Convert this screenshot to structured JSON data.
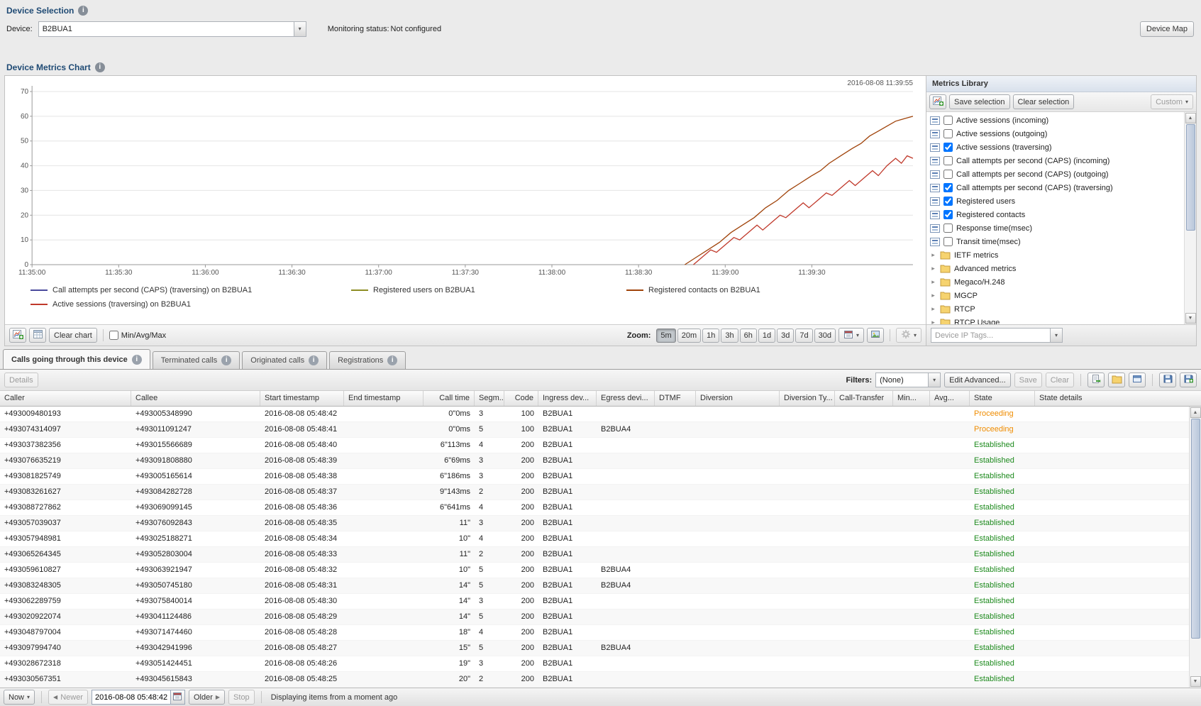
{
  "icons": {
    "caret_down": "▾",
    "caret_right": "▸",
    "arrow_left": "◀",
    "arrow_right": "▶",
    "info": "i"
  },
  "device_selection": {
    "title": "Device Selection",
    "device_label": "Device:",
    "device_value": "B2BUA1",
    "monitoring_label": "Monitoring status:",
    "monitoring_value": "Not configured",
    "device_map_button": "Device Map"
  },
  "metrics_chart": {
    "title": "Device Metrics Chart",
    "toolbar": {
      "clear_chart_button": "Clear chart",
      "min_avg_max_label": "Min/Avg/Max",
      "zoom_label": "Zoom:",
      "zoom_options": [
        "5m",
        "20m",
        "1h",
        "3h",
        "6h",
        "1d",
        "3d",
        "7d",
        "30d"
      ],
      "zoom_active": "5m"
    }
  },
  "chart_data": {
    "type": "line",
    "timestamp_label": "2016-08-08 11:39:55",
    "ylim": [
      0,
      70
    ],
    "y_ticks": [
      0,
      10,
      20,
      30,
      40,
      50,
      60,
      70
    ],
    "x_domain_seconds": [
      0,
      305
    ],
    "x_tick_interval_seconds": 30,
    "x_ticks": [
      "11:35:00",
      "11:35:30",
      "11:36:00",
      "11:36:30",
      "11:37:00",
      "11:37:30",
      "11:38:00",
      "11:38:30",
      "11:39:00",
      "11:39:30"
    ],
    "grid": "horizontal",
    "legend_position": "bottom",
    "series": [
      {
        "name": "Call attempts per second (CAPS) (traversing) on B2BUA1",
        "color": "#4a4a9c",
        "points": []
      },
      {
        "name": "Registered users on B2BUA1",
        "color": "#8e8e24",
        "points": []
      },
      {
        "name": "Registered contacts on B2BUA1",
        "color": "#a0430a",
        "points": [
          [
            226,
            0
          ],
          [
            230,
            3
          ],
          [
            234,
            6
          ],
          [
            238,
            9
          ],
          [
            242,
            13
          ],
          [
            246,
            16
          ],
          [
            250,
            19
          ],
          [
            254,
            23
          ],
          [
            258,
            26
          ],
          [
            262,
            30
          ],
          [
            266,
            33
          ],
          [
            270,
            36
          ],
          [
            273,
            38
          ],
          [
            276,
            41
          ],
          [
            280,
            44
          ],
          [
            284,
            47
          ],
          [
            287,
            49
          ],
          [
            290,
            52
          ],
          [
            293,
            54
          ],
          [
            296,
            56
          ],
          [
            299,
            58
          ],
          [
            302,
            59
          ],
          [
            305,
            60
          ]
        ]
      },
      {
        "name": "Active sessions (traversing) on B2BUA1",
        "color": "#c0392b",
        "points": [
          [
            229,
            0
          ],
          [
            232,
            3
          ],
          [
            235,
            6
          ],
          [
            237,
            5
          ],
          [
            240,
            8
          ],
          [
            243,
            11
          ],
          [
            245,
            10
          ],
          [
            248,
            13
          ],
          [
            251,
            16
          ],
          [
            253,
            14
          ],
          [
            256,
            17
          ],
          [
            259,
            20
          ],
          [
            261,
            19
          ],
          [
            264,
            22
          ],
          [
            267,
            25
          ],
          [
            269,
            23
          ],
          [
            272,
            26
          ],
          [
            275,
            29
          ],
          [
            277,
            28
          ],
          [
            280,
            31
          ],
          [
            283,
            34
          ],
          [
            285,
            32
          ],
          [
            288,
            35
          ],
          [
            291,
            38
          ],
          [
            293,
            36
          ],
          [
            296,
            40
          ],
          [
            299,
            43
          ],
          [
            301,
            41
          ],
          [
            303,
            44
          ],
          [
            305,
            43
          ]
        ]
      }
    ]
  },
  "metrics_library": {
    "title": "Metrics Library",
    "toolbar": {
      "save_selection": "Save selection",
      "clear_selection": "Clear selection",
      "custom": "Custom"
    },
    "metrics": [
      {
        "label": "Active sessions (incoming)",
        "checked": false
      },
      {
        "label": "Active sessions (outgoing)",
        "checked": false
      },
      {
        "label": "Active sessions (traversing)",
        "checked": true
      },
      {
        "label": "Call attempts per second (CAPS) (incoming)",
        "checked": false
      },
      {
        "label": "Call attempts per second (CAPS) (outgoing)",
        "checked": false
      },
      {
        "label": "Call attempts per second (CAPS) (traversing)",
        "checked": true
      },
      {
        "label": "Registered users",
        "checked": true
      },
      {
        "label": "Registered contacts",
        "checked": true
      },
      {
        "label": "Response time(msec)",
        "checked": false
      },
      {
        "label": "Transit time(msec)",
        "checked": false
      }
    ],
    "folders": [
      "IETF metrics",
      "Advanced metrics",
      "Megaco/H.248",
      "MGCP",
      "RTCP",
      "RTCP Usage"
    ],
    "device_ip_tags": "Device IP Tags..."
  },
  "tabs": [
    {
      "label": "Calls going through this device",
      "active": true
    },
    {
      "label": "Terminated calls",
      "active": false
    },
    {
      "label": "Originated calls",
      "active": false
    },
    {
      "label": "Registrations",
      "active": false
    }
  ],
  "grid": {
    "details_button": "Details",
    "filters_label": "Filters:",
    "filters_value": "(None)",
    "edit_advanced_button": "Edit Advanced...",
    "save_button": "Save",
    "clear_button": "Clear",
    "columns": [
      "Caller",
      "Callee",
      "Start timestamp",
      "End timestamp",
      "Call time",
      "Segm...",
      "Code",
      "Ingress dev...",
      "Egress devi...",
      "DTMF",
      "Diversion",
      "Diversion Ty...",
      "Call-Transfer",
      "Min...",
      "Avg...",
      "State",
      "State details"
    ],
    "state_colors": {
      "Proceeding": "#ef8c00",
      "Established": "#1d8a1d"
    },
    "rows": [
      [
        "+493009480193",
        "+493005348990",
        "2016-08-08 05:48:42",
        "",
        "0\"0ms",
        "3",
        "100",
        "B2BUA1",
        "",
        "",
        "",
        "",
        "",
        "",
        "",
        "Proceeding",
        ""
      ],
      [
        "+493074314097",
        "+493011091247",
        "2016-08-08 05:48:41",
        "",
        "0\"0ms",
        "5",
        "100",
        "B2BUA1",
        "B2BUA4",
        "",
        "",
        "",
        "",
        "",
        "",
        "Proceeding",
        ""
      ],
      [
        "+493037382356",
        "+493015566689",
        "2016-08-08 05:48:40",
        "",
        "6\"113ms",
        "4",
        "200",
        "B2BUA1",
        "",
        "",
        "",
        "",
        "",
        "",
        "",
        "Established",
        ""
      ],
      [
        "+493076635219",
        "+493091808880",
        "2016-08-08 05:48:39",
        "",
        "6\"69ms",
        "3",
        "200",
        "B2BUA1",
        "",
        "",
        "",
        "",
        "",
        "",
        "",
        "Established",
        ""
      ],
      [
        "+493081825749",
        "+493005165614",
        "2016-08-08 05:48:38",
        "",
        "6\"186ms",
        "3",
        "200",
        "B2BUA1",
        "",
        "",
        "",
        "",
        "",
        "",
        "",
        "Established",
        ""
      ],
      [
        "+493083261627",
        "+493084282728",
        "2016-08-08 05:48:37",
        "",
        "9\"143ms",
        "2",
        "200",
        "B2BUA1",
        "",
        "",
        "",
        "",
        "",
        "",
        "",
        "Established",
        ""
      ],
      [
        "+493088727862",
        "+493069099145",
        "2016-08-08 05:48:36",
        "",
        "6\"641ms",
        "4",
        "200",
        "B2BUA1",
        "",
        "",
        "",
        "",
        "",
        "",
        "",
        "Established",
        ""
      ],
      [
        "+493057039037",
        "+493076092843",
        "2016-08-08 05:48:35",
        "",
        "11\"",
        "3",
        "200",
        "B2BUA1",
        "",
        "",
        "",
        "",
        "",
        "",
        "",
        "Established",
        ""
      ],
      [
        "+493057948981",
        "+493025188271",
        "2016-08-08 05:48:34",
        "",
        "10\"",
        "4",
        "200",
        "B2BUA1",
        "",
        "",
        "",
        "",
        "",
        "",
        "",
        "Established",
        ""
      ],
      [
        "+493065264345",
        "+493052803004",
        "2016-08-08 05:48:33",
        "",
        "11\"",
        "2",
        "200",
        "B2BUA1",
        "",
        "",
        "",
        "",
        "",
        "",
        "",
        "Established",
        ""
      ],
      [
        "+493059610827",
        "+493063921947",
        "2016-08-08 05:48:32",
        "",
        "10\"",
        "5",
        "200",
        "B2BUA1",
        "B2BUA4",
        "",
        "",
        "",
        "",
        "",
        "",
        "Established",
        ""
      ],
      [
        "+493083248305",
        "+493050745180",
        "2016-08-08 05:48:31",
        "",
        "14\"",
        "5",
        "200",
        "B2BUA1",
        "B2BUA4",
        "",
        "",
        "",
        "",
        "",
        "",
        "Established",
        ""
      ],
      [
        "+493062289759",
        "+493075840014",
        "2016-08-08 05:48:30",
        "",
        "14\"",
        "3",
        "200",
        "B2BUA1",
        "",
        "",
        "",
        "",
        "",
        "",
        "",
        "Established",
        ""
      ],
      [
        "+493020922074",
        "+493041124486",
        "2016-08-08 05:48:29",
        "",
        "14\"",
        "5",
        "200",
        "B2BUA1",
        "",
        "",
        "",
        "",
        "",
        "",
        "",
        "Established",
        ""
      ],
      [
        "+493048797004",
        "+493071474460",
        "2016-08-08 05:48:28",
        "",
        "18\"",
        "4",
        "200",
        "B2BUA1",
        "",
        "",
        "",
        "",
        "",
        "",
        "",
        "Established",
        ""
      ],
      [
        "+493097994740",
        "+493042941996",
        "2016-08-08 05:48:27",
        "",
        "15\"",
        "5",
        "200",
        "B2BUA1",
        "B2BUA4",
        "",
        "",
        "",
        "",
        "",
        "",
        "Established",
        ""
      ],
      [
        "+493028672318",
        "+493051424451",
        "2016-08-08 05:48:26",
        "",
        "19\"",
        "3",
        "200",
        "B2BUA1",
        "",
        "",
        "",
        "",
        "",
        "",
        "",
        "Established",
        ""
      ],
      [
        "+493030567351",
        "+493045615843",
        "2016-08-08 05:48:25",
        "",
        "20\"",
        "2",
        "200",
        "B2BUA1",
        "",
        "",
        "",
        "",
        "",
        "",
        "",
        "Established",
        ""
      ]
    ]
  },
  "paging": {
    "now_button": "Now",
    "newer_button": "Newer",
    "date_value": "2016-08-08 05:48:42",
    "older_button": "Older",
    "stop_button": "Stop",
    "status_text": "Displaying items from a moment ago"
  }
}
